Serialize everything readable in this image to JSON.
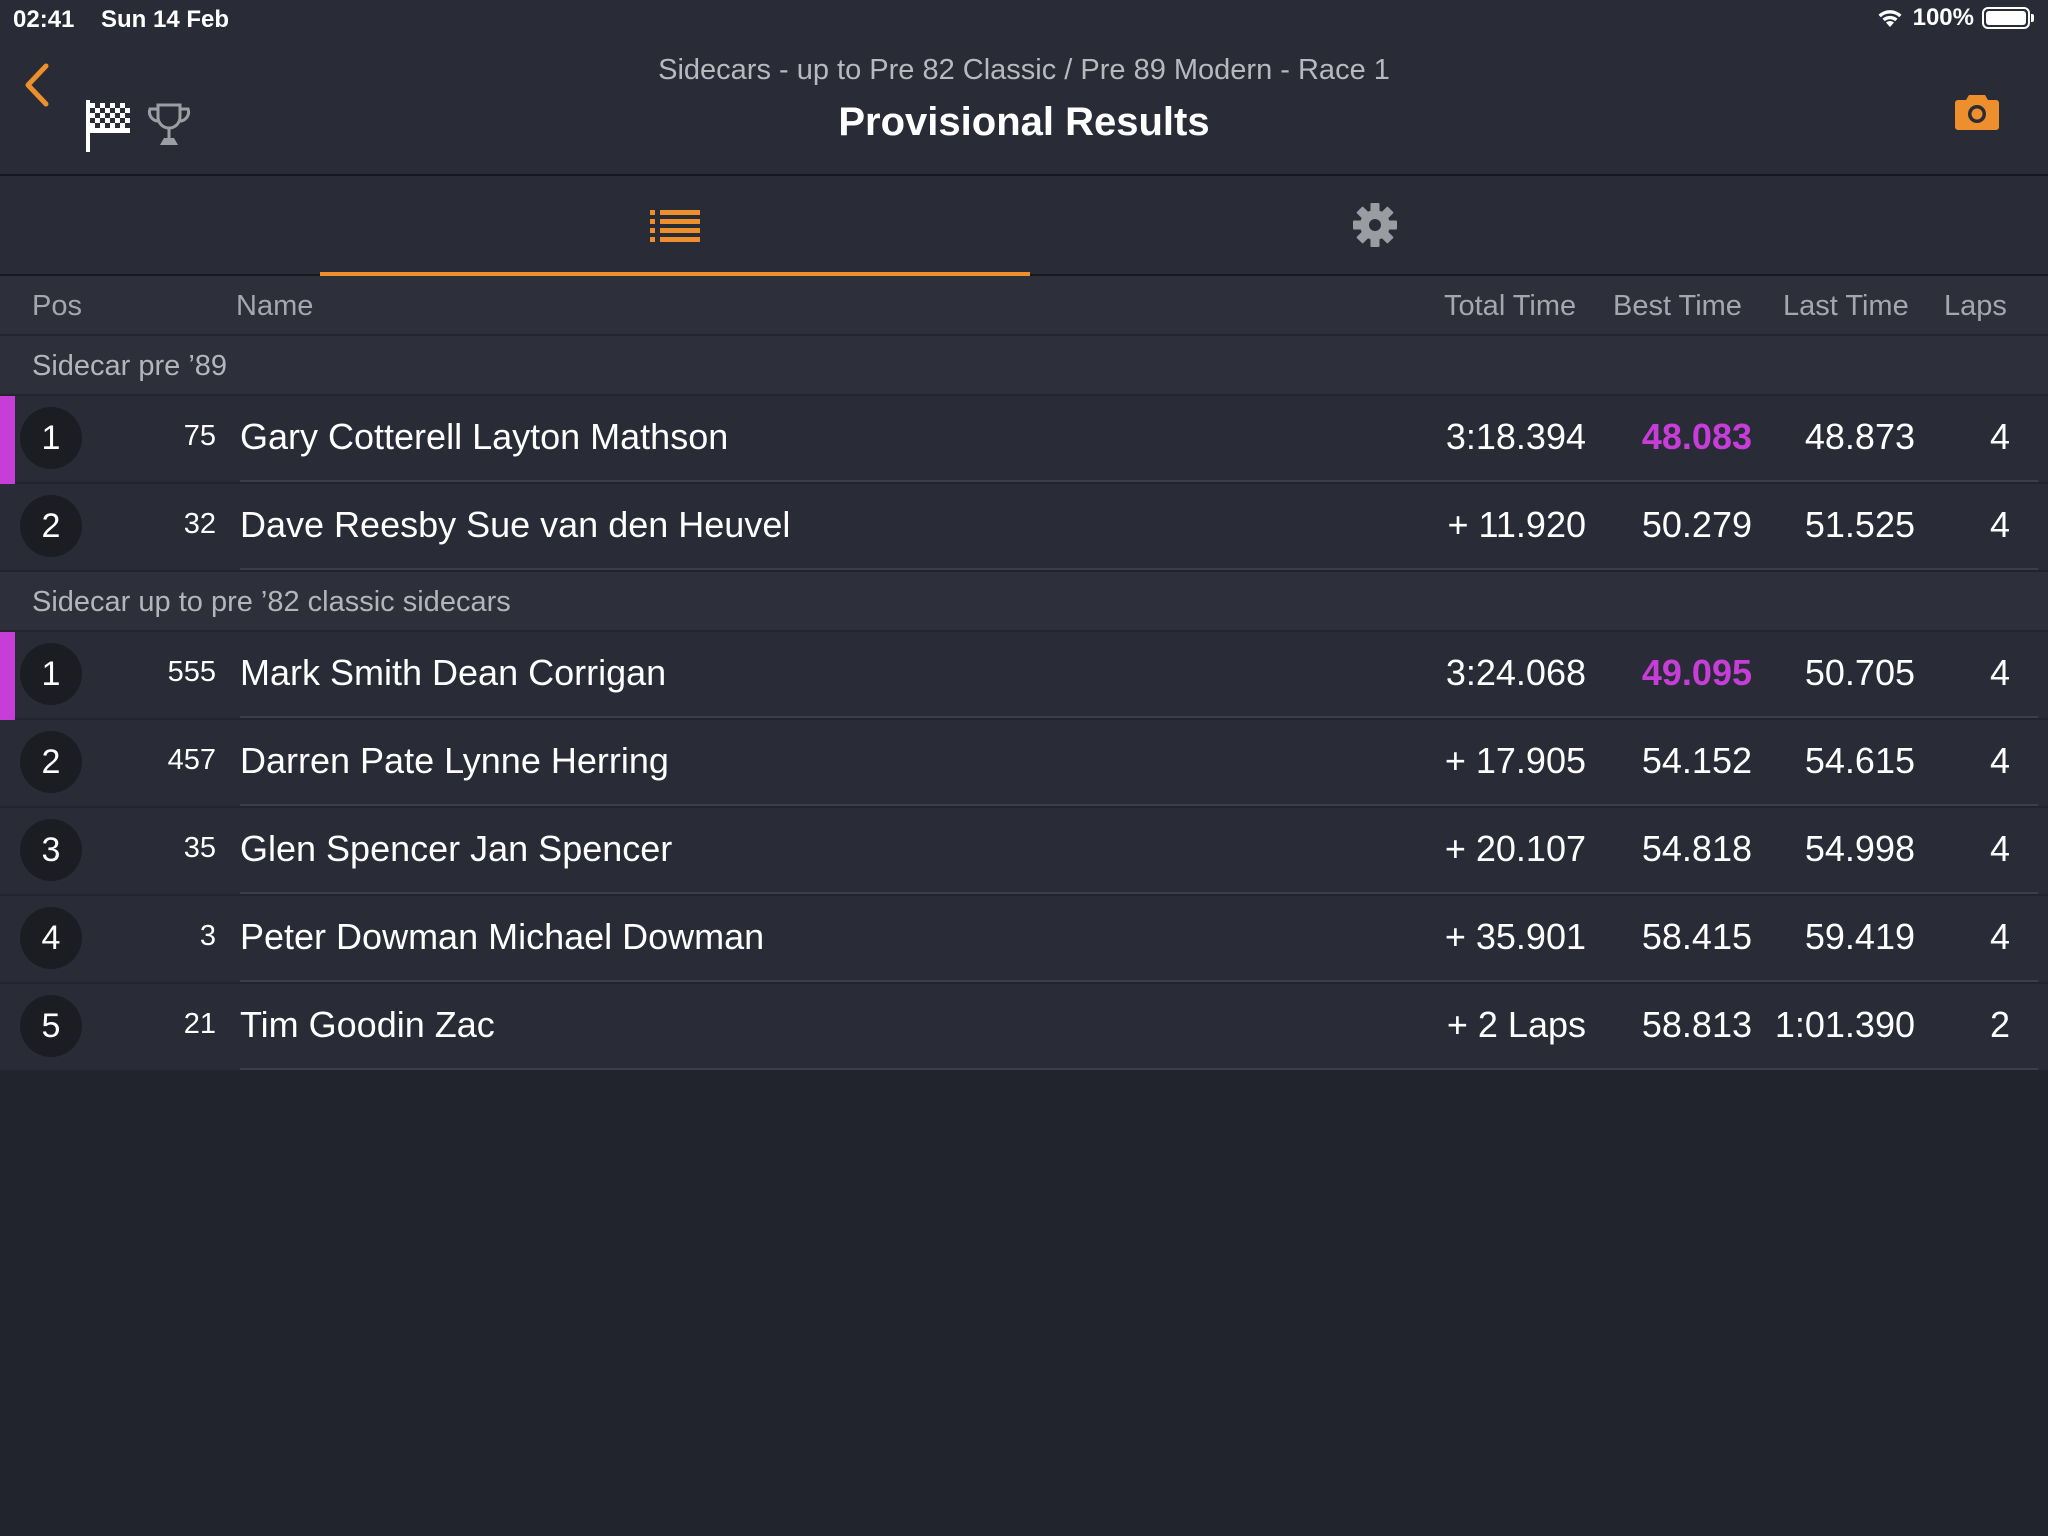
{
  "status_bar": {
    "time": "02:41",
    "date": "Sun 14 Feb",
    "battery": "100%"
  },
  "header": {
    "subtitle": "Sidecars - up to Pre 82 Classic / Pre 89 Modern - Race 1",
    "title": "Provisional Results"
  },
  "colors": {
    "accent": "#ec8f2c",
    "fastest": "#c63dd7",
    "background": "#21242d",
    "panel": "#292c36"
  },
  "icons": [
    "back-chevron-icon",
    "checkered-flag-icon",
    "trophy-icon",
    "camera-icon",
    "list-icon",
    "gear-icon",
    "wifi-icon",
    "battery-icon"
  ],
  "tabs": {
    "active": "list"
  },
  "columns": {
    "pos": "Pos",
    "name": "Name",
    "total": "Total Time",
    "best": "Best Time",
    "last": "Last Time",
    "laps": "Laps"
  },
  "sections": [
    {
      "title": "Sidecar pre ’89",
      "rows": [
        {
          "pos": "1",
          "num": "75",
          "name": "Gary Cotterell Layton Mathson",
          "total": "3:18.394",
          "best": "48.083",
          "last": "48.873",
          "laps": "4"
        },
        {
          "pos": "2",
          "num": "32",
          "name": "Dave Reesby Sue van den Heuvel",
          "total": "+ 11.920",
          "best": "50.279",
          "last": "51.525",
          "laps": "4"
        }
      ]
    },
    {
      "title": "Sidecar up to pre ’82 classic sidecars",
      "rows": [
        {
          "pos": "1",
          "num": "555",
          "name": "Mark Smith Dean Corrigan",
          "total": "3:24.068",
          "best": "49.095",
          "last": "50.705",
          "laps": "4"
        },
        {
          "pos": "2",
          "num": "457",
          "name": "Darren Pate Lynne Herring",
          "total": "+ 17.905",
          "best": "54.152",
          "last": "54.615",
          "laps": "4"
        },
        {
          "pos": "3",
          "num": "35",
          "name": "Glen Spencer Jan Spencer",
          "total": "+ 20.107",
          "best": "54.818",
          "last": "54.998",
          "laps": "4"
        },
        {
          "pos": "4",
          "num": "3",
          "name": "Peter Dowman Michael Dowman",
          "total": "+ 35.901",
          "best": "58.415",
          "last": "59.419",
          "laps": "4"
        },
        {
          "pos": "5",
          "num": "21",
          "name": "Tim Goodin Zac",
          "total": "+ 2 Laps",
          "best": "58.813",
          "last": "1:01.390",
          "laps": "2"
        }
      ]
    }
  ]
}
